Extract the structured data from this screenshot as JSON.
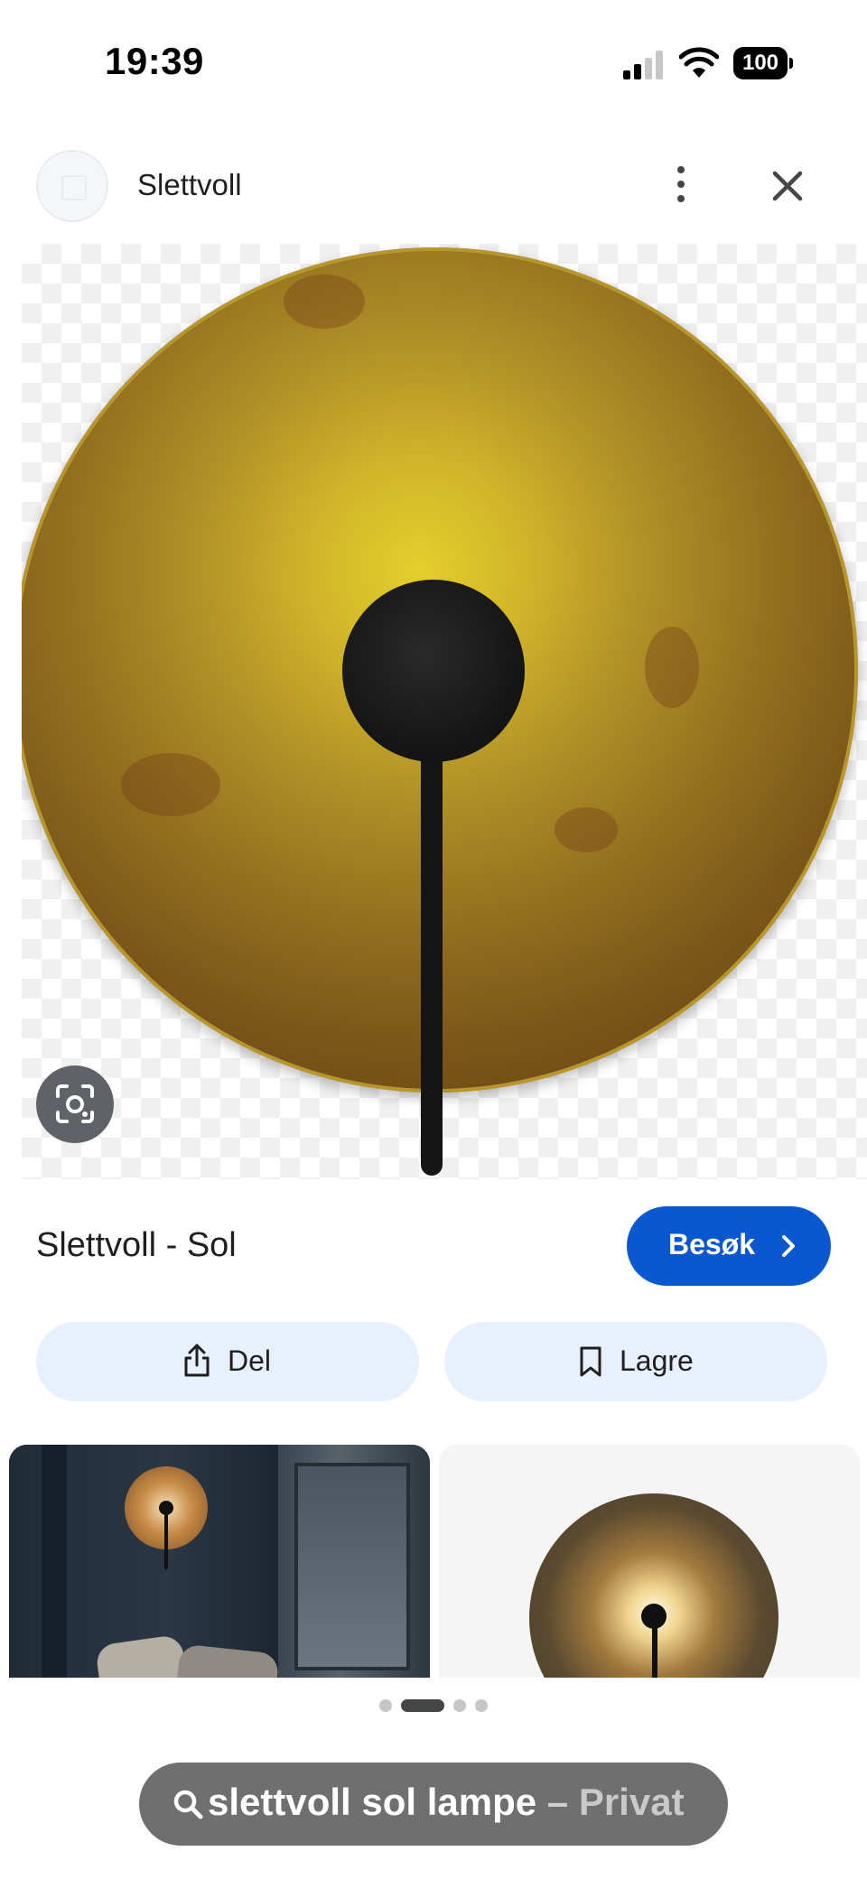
{
  "status_bar": {
    "time": "19:39",
    "battery": "100",
    "icons": [
      "cellular-signal-icon",
      "wifi-icon",
      "battery-icon"
    ]
  },
  "header": {
    "site_name": "Slettvoll",
    "icons": [
      "site-favicon-icon",
      "more-vert-icon",
      "close-icon"
    ]
  },
  "image": {
    "lens_icon": "google-lens-icon"
  },
  "title": {
    "text": "Slettvoll - Sol",
    "visit_label": "Besøk",
    "visit_icon": "chevron-right-icon",
    "accent_color": "#0b57d0"
  },
  "actions": {
    "share_label": "Del",
    "share_icon": "share-icon",
    "save_label": "Lagre",
    "save_icon": "bookmark-icon",
    "button_color": "#e8f0fd"
  },
  "carousel": {
    "dot_count": 4,
    "active_index": 1
  },
  "search": {
    "query": "slettvoll sol lampe",
    "separator": "–",
    "mode": "Privat",
    "icon": "search-icon"
  }
}
